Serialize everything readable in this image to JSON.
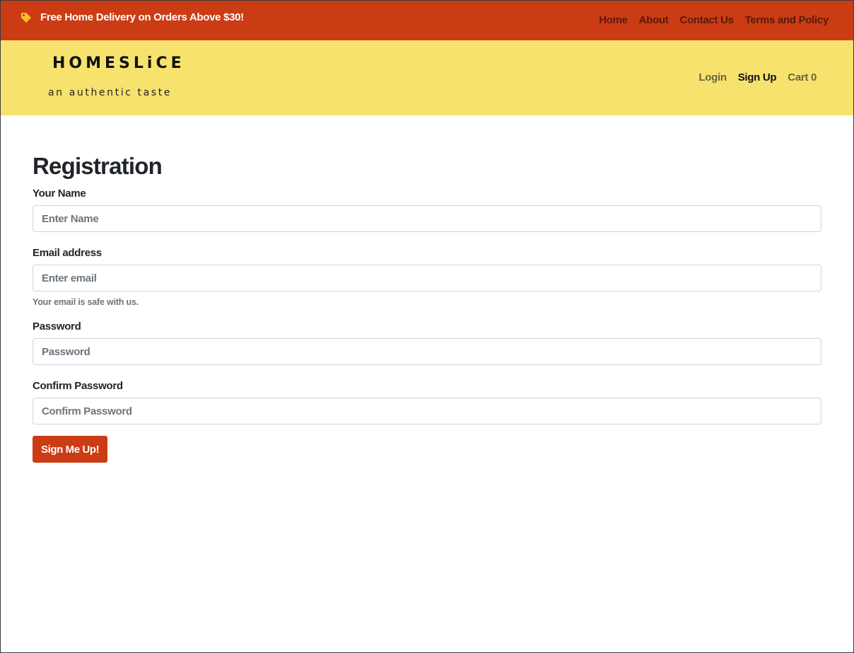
{
  "topbar": {
    "promo_icon": "tag-icon",
    "promo_text": "Free Home Delivery on Orders Above $30!",
    "nav": {
      "home": "Home",
      "about": "About",
      "contact": "Contact Us",
      "terms": "Terms and Policy"
    },
    "bg_color": "#cb3c14"
  },
  "header": {
    "brand": "HOMESLiCE",
    "tagline": "an authentic taste",
    "bg_color": "#f7e26d",
    "user_nav": {
      "login": "Login",
      "signup": "Sign Up",
      "cart": "Cart 0"
    }
  },
  "form": {
    "title": "Registration",
    "name_label": "Your Name",
    "name_placeholder": "Enter Name",
    "email_label": "Email address",
    "email_placeholder": "Enter email",
    "email_help": "Your email is safe with us.",
    "password_label": "Password",
    "password_placeholder": "Password",
    "confirm_label": "Confirm Password",
    "confirm_placeholder": "Confirm Password",
    "submit_label": "Sign Me Up!"
  }
}
